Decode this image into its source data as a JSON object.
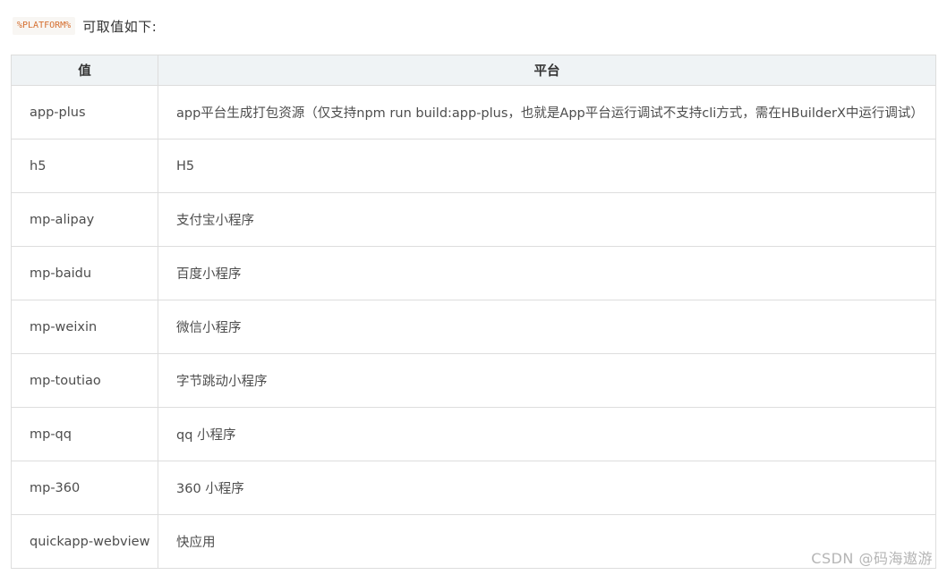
{
  "intro": {
    "code": "%PLATFORM%",
    "text": "可取值如下:"
  },
  "table": {
    "headers": [
      "值",
      "平台"
    ],
    "rows": [
      {
        "value": "app-plus",
        "platform": "app平台生成打包资源（仅支持npm run build:app-plus，也就是App平台运行调试不支持cli方式，需在HBuilderX中运行调试）"
      },
      {
        "value": "h5",
        "platform": "H5"
      },
      {
        "value": "mp-alipay",
        "platform": "支付宝小程序"
      },
      {
        "value": "mp-baidu",
        "platform": "百度小程序"
      },
      {
        "value": "mp-weixin",
        "platform": "微信小程序"
      },
      {
        "value": "mp-toutiao",
        "platform": "字节跳动小程序"
      },
      {
        "value": "mp-qq",
        "platform": "qq 小程序"
      },
      {
        "value": "mp-360",
        "platform": "360 小程序"
      },
      {
        "value": "quickapp-webview",
        "platform": "快应用"
      }
    ]
  },
  "watermark": "CSDN @码海遨游"
}
